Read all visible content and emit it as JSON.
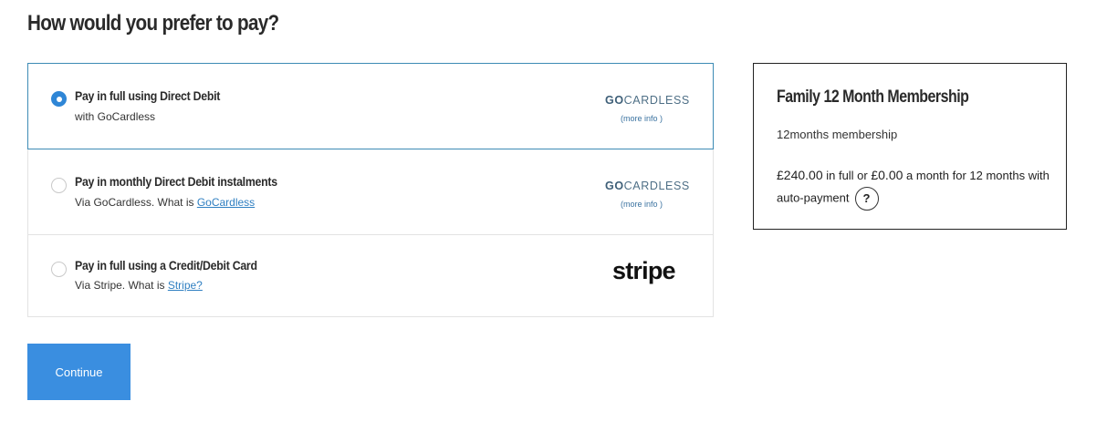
{
  "page": {
    "heading": "How would you prefer to pay?"
  },
  "options": [
    {
      "title": "Pay in full using Direct Debit",
      "sub": "with GoCardless",
      "logo_go": "GO",
      "logo_rest": "CARDLESS",
      "more_info": "(more info )",
      "selected": true
    },
    {
      "title": "Pay in monthly Direct Debit instalments",
      "sub_prefix": "Via GoCardless. What is ",
      "sub_link": "GoCardless",
      "logo_go": "GO",
      "logo_rest": "CARDLESS",
      "more_info": "(more info )",
      "selected": false
    },
    {
      "title": "Pay in full using a Credit/Debit Card",
      "sub_prefix": "Via Stripe. What is ",
      "sub_link": "Stripe?",
      "logo": "stripe",
      "selected": false
    }
  ],
  "continue_label": "Continue",
  "summary": {
    "title": "Family 12 Month Membership",
    "desc": "12months membership",
    "price_full": "£240.00",
    "text_mid": " in full or ",
    "price_month": "£0.00",
    "text_end": " a month for 12 months with auto-payment",
    "help_label": "?"
  },
  "colors": {
    "accent": "#3a8ee0",
    "selected_border": "#3d8bb5",
    "link": "#2f7fc1"
  }
}
